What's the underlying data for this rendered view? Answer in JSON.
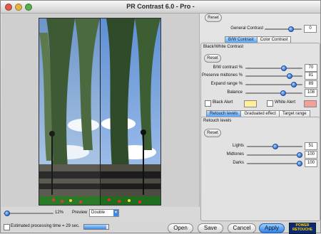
{
  "window": {
    "title": "PR Contrast 6.0 - Pro -"
  },
  "general": {
    "reset": "Reset",
    "label": "General Contrast",
    "value": "0",
    "level": 0.75
  },
  "mode_tabs": [
    "B/W Contrast",
    "Color Contrast"
  ],
  "bw": {
    "title": "Black/White Contrast",
    "reset": "Reset",
    "rows": [
      {
        "label": "B/W contrast %",
        "value": "70",
        "level": 0.7
      },
      {
        "label": "Preserve midtones %",
        "value": "81",
        "level": 0.81
      },
      {
        "label": "Expand range %",
        "value": "89",
        "level": 0.89
      },
      {
        "label": "Balance",
        "value": "108",
        "level": 0.68
      }
    ],
    "black_alert": "Black Alert",
    "white_alert": "White Alert",
    "colors": {
      "black_alert": "#fff19a",
      "white_alert": "#f3a09a"
    }
  },
  "adj_tabs": [
    "Retouch levels",
    "Graduated effect",
    "Target range"
  ],
  "retouch": {
    "title": "Retouch levels",
    "reset": "Reset",
    "rows": [
      {
        "label": "Lights",
        "value": "51",
        "level": 0.51
      },
      {
        "label": "Midtones",
        "value": "100",
        "level": 1.0
      },
      {
        "label": "Darks",
        "value": "100",
        "level": 1.0
      }
    ]
  },
  "zoom": {
    "value": "12%",
    "level": 0.02
  },
  "preview": {
    "label": "Preview",
    "selected": "Double"
  },
  "status": {
    "text": "Estimated processing time = 29 sec.",
    "progress": 0.9
  },
  "buttons": {
    "open": "Open",
    "save": "Save",
    "cancel": "Cancel",
    "apply": "Apply"
  },
  "logo": {
    "line1": "POWER",
    "line2": "RETOUCHE"
  }
}
